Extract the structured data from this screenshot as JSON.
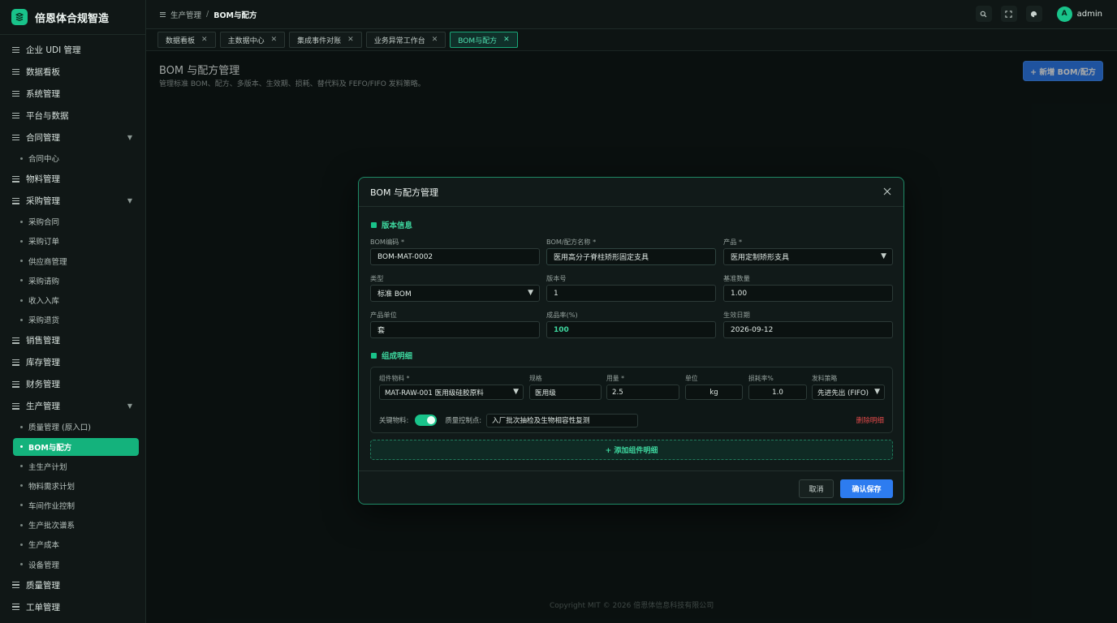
{
  "brand": {
    "name": "倍恩体合规智造"
  },
  "sidebar": {
    "items": [
      {
        "label": "企业 UDI 管理",
        "type": "group"
      },
      {
        "label": "数据看板",
        "type": "group"
      },
      {
        "label": "系统管理",
        "type": "group"
      },
      {
        "label": "平台与数据",
        "type": "group"
      },
      {
        "label": "合同管理",
        "type": "group",
        "expanded": true
      },
      {
        "label": "合同中心",
        "type": "sub"
      },
      {
        "label": "物料管理",
        "type": "group"
      },
      {
        "label": "采购管理",
        "type": "group",
        "expanded": true
      },
      {
        "label": "采购合同",
        "type": "sub"
      },
      {
        "label": "采购订单",
        "type": "sub"
      },
      {
        "label": "供应商管理",
        "type": "sub"
      },
      {
        "label": "采购请购",
        "type": "sub"
      },
      {
        "label": "收入入库",
        "type": "sub"
      },
      {
        "label": "采购退货",
        "type": "sub"
      },
      {
        "label": "销售管理",
        "type": "group"
      },
      {
        "label": "库存管理",
        "type": "group"
      },
      {
        "label": "财务管理",
        "type": "group"
      },
      {
        "label": "生产管理",
        "type": "group",
        "expanded": true
      },
      {
        "label": "质量管理 (原入口)",
        "type": "sub"
      },
      {
        "label": "BOM与配方",
        "type": "sub",
        "active": true
      },
      {
        "label": "主生产计划",
        "type": "sub"
      },
      {
        "label": "物料需求计划",
        "type": "sub"
      },
      {
        "label": "车间作业控制",
        "type": "sub"
      },
      {
        "label": "生产批次谱系",
        "type": "sub"
      },
      {
        "label": "生产成本",
        "type": "sub"
      },
      {
        "label": "设备管理",
        "type": "sub"
      },
      {
        "label": "质量管理",
        "type": "group"
      },
      {
        "label": "工单管理",
        "type": "group"
      }
    ]
  },
  "header": {
    "breadcrumb_parent": "生产管理",
    "breadcrumb_sep": "/",
    "breadcrumb_current": "BOM与配方",
    "user": "admin",
    "avatar_letter": "A"
  },
  "tabs": [
    {
      "label": "数据看板"
    },
    {
      "label": "主数据中心"
    },
    {
      "label": "集成事件对账"
    },
    {
      "label": "业务异常工作台"
    },
    {
      "label": "BOM与配方",
      "active": true
    }
  ],
  "page": {
    "title": "BOM 与配方管理",
    "subtitle": "管理标准 BOM、配方、多版本、生效期、损耗、替代料及 FEFO/FIFO 发料策略。",
    "new_button": "+ 新增 BOM/配方",
    "footer": "Copyright MIT © 2026 倍恩体信息科技有限公司"
  },
  "modal": {
    "title": "BOM 与配方管理",
    "section_version": "版本信息",
    "section_components": "组成明细",
    "fields": {
      "bom_code_label": "BOM编码 *",
      "bom_code": "BOM-MAT-0002",
      "bom_name_label": "BOM/配方名称 *",
      "bom_name": "医用高分子脊柱矫形固定支具",
      "product_label": "产品 *",
      "product": "医用定制矫形支具",
      "type_label": "类型",
      "type": "标准 BOM",
      "version_label": "版本号",
      "version": "1",
      "base_qty_label": "基准数量",
      "base_qty": "1.00",
      "unit_label": "产品单位",
      "unit": "套",
      "yield_label": "成品率(%)",
      "yield": "100",
      "effective_label": "生效日期",
      "effective": "2026-09-12"
    },
    "component": {
      "material_label": "组件物料 *",
      "material": "MAT-RAW-001 医用级硅胶原料",
      "spec_label": "规格",
      "spec": "医用级",
      "qty_label": "用量 *",
      "qty": "2.5",
      "unit_label": "单位",
      "unit": "kg",
      "loss_label": "损耗率%",
      "loss": "1.0",
      "strategy_label": "发料策略",
      "strategy": "先进先出 (FIFO)",
      "key_label": "关键物料:",
      "key_on": true,
      "qc_label": "质量控制点:",
      "qc": "入厂批次抽检及生物相容性复测",
      "delete": "删除明细"
    },
    "add_component": "+ 添加组件明细",
    "cancel": "取消",
    "confirm": "确认保存"
  },
  "colors": {
    "accent": "#19c38a",
    "primary_button": "#2d7cf0",
    "danger": "#e24a4a",
    "background": "#0d1413"
  }
}
